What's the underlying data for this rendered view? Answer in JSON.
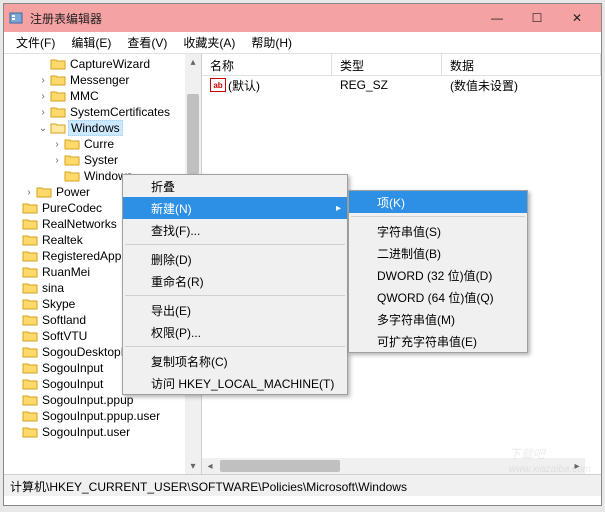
{
  "window": {
    "title": "注册表编辑器"
  },
  "menubar": [
    "文件(F)",
    "编辑(E)",
    "查看(V)",
    "收藏夹(A)",
    "帮助(H)"
  ],
  "tree": [
    {
      "label": "CaptureWizard",
      "indent": 2,
      "exp": ""
    },
    {
      "label": "Messenger",
      "indent": 2,
      "exp": "›"
    },
    {
      "label": "MMC",
      "indent": 2,
      "exp": "›"
    },
    {
      "label": "SystemCertificates",
      "indent": 2,
      "exp": "›"
    },
    {
      "label": "Windows",
      "indent": 2,
      "exp": "⌄",
      "selected": true,
      "open": true
    },
    {
      "label": "Curre",
      "indent": 3,
      "exp": "›"
    },
    {
      "label": "Syster",
      "indent": 3,
      "exp": "›"
    },
    {
      "label": "Windows",
      "indent": 3,
      "exp": ""
    },
    {
      "label": "Power",
      "indent": 1,
      "exp": "›"
    },
    {
      "label": "PureCodec",
      "indent": 0,
      "exp": ""
    },
    {
      "label": "RealNetworks",
      "indent": 0,
      "exp": ""
    },
    {
      "label": "Realtek",
      "indent": 0,
      "exp": ""
    },
    {
      "label": "RegisteredAppl",
      "indent": 0,
      "exp": ""
    },
    {
      "label": "RuanMei",
      "indent": 0,
      "exp": ""
    },
    {
      "label": "sina",
      "indent": 0,
      "exp": ""
    },
    {
      "label": "Skype",
      "indent": 0,
      "exp": ""
    },
    {
      "label": "Softland",
      "indent": 0,
      "exp": ""
    },
    {
      "label": "SoftVTU",
      "indent": 0,
      "exp": ""
    },
    {
      "label": "SogouDesktopBar",
      "indent": 0,
      "exp": ""
    },
    {
      "label": "SogouInput",
      "indent": 0,
      "exp": ""
    },
    {
      "label": "SogouInput",
      "indent": 0,
      "exp": ""
    },
    {
      "label": "SogouInput.ppup",
      "indent": 0,
      "exp": ""
    },
    {
      "label": "SogouInput.ppup.user",
      "indent": 0,
      "exp": ""
    },
    {
      "label": "SogouInput.user",
      "indent": 0,
      "exp": ""
    }
  ],
  "list": {
    "cols": {
      "name": "名称",
      "type": "类型",
      "data": "数据"
    },
    "row": {
      "name": "(默认)",
      "type": "REG_SZ",
      "data": "(数值未设置)"
    }
  },
  "ctx1": [
    {
      "label": "折叠"
    },
    {
      "label": "新建(N)",
      "hl": true,
      "sub": true
    },
    {
      "label": "查找(F)..."
    },
    {
      "sep": true
    },
    {
      "label": "删除(D)"
    },
    {
      "label": "重命名(R)"
    },
    {
      "sep": true
    },
    {
      "label": "导出(E)"
    },
    {
      "label": "权限(P)..."
    },
    {
      "sep": true
    },
    {
      "label": "复制项名称(C)"
    },
    {
      "label": "访问 HKEY_LOCAL_MACHINE(T)"
    }
  ],
  "ctx2": [
    {
      "label": "项(K)",
      "hl": true
    },
    {
      "sep": true
    },
    {
      "label": "字符串值(S)"
    },
    {
      "label": "二进制值(B)"
    },
    {
      "label": "DWORD (32 位)值(D)"
    },
    {
      "label": "QWORD (64 位)值(Q)"
    },
    {
      "label": "多字符串值(M)"
    },
    {
      "label": "可扩充字符串值(E)"
    }
  ],
  "statusbar": "计算机\\HKEY_CURRENT_USER\\SOFTWARE\\Policies\\Microsoft\\Windows",
  "watermark": {
    "main": "下载吧",
    "sub": "www.xiazaiba.com"
  },
  "string_icon_text": "ab"
}
